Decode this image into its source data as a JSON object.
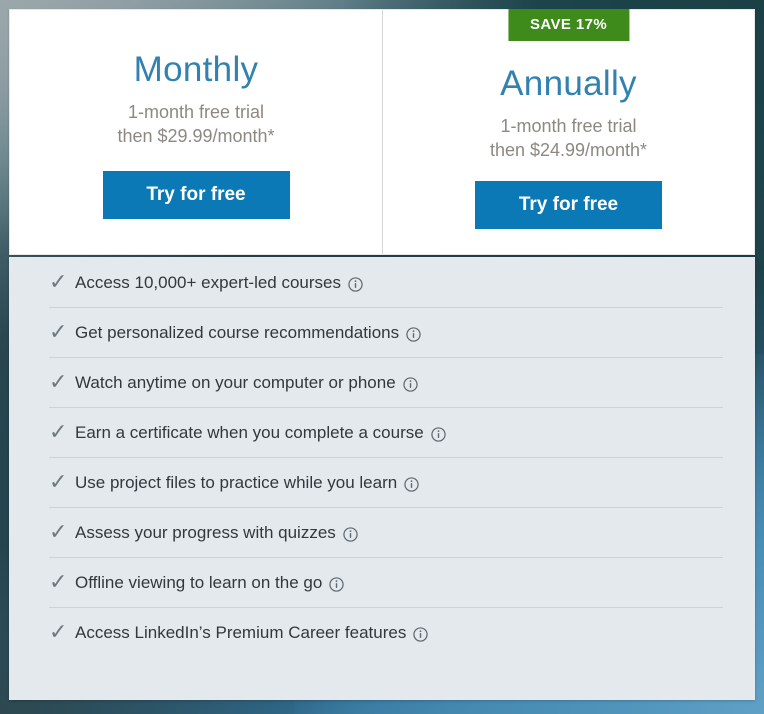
{
  "plans": [
    {
      "id": "monthly",
      "title": "Monthly",
      "trial_line": "1-month free trial",
      "price_line": "then $29.99/month*",
      "cta_label": "Try for free",
      "badge": null
    },
    {
      "id": "annually",
      "title": "Annually",
      "trial_line": "1-month free trial",
      "price_line": "then $24.99/month*",
      "cta_label": "Try for free",
      "badge": "SAVE 17%"
    }
  ],
  "features": [
    {
      "text": "Access 10,000+ expert-led courses",
      "check": "check-icon",
      "info": "info-icon"
    },
    {
      "text": "Get personalized course recommendations",
      "check": "check-icon",
      "info": "info-icon"
    },
    {
      "text": "Watch anytime on your computer or phone",
      "check": "check-icon",
      "info": "info-icon"
    },
    {
      "text": "Earn a certificate when you complete a course",
      "check": "check-icon",
      "info": "info-icon"
    },
    {
      "text": "Use project files to practice while you learn",
      "check": "check-icon",
      "info": "info-icon"
    },
    {
      "text": "Assess your progress with quizzes",
      "check": "check-icon",
      "info": "info-icon"
    },
    {
      "text": "Offline viewing to learn on the go",
      "check": "check-icon",
      "info": "info-icon"
    },
    {
      "text": "Access LinkedIn’s Premium Career features",
      "check": "check-icon",
      "info": "info-icon"
    }
  ],
  "icons": {
    "check_glyph": "✓"
  },
  "colors": {
    "cta_blue": "#0b79b5",
    "title_blue": "#3282b0",
    "badge_green": "#3e8a1b",
    "panel_gray": "#e3e9ed",
    "price_gray": "#8d8882",
    "feature_text": "#32383d",
    "divider": "#ccd4d9"
  }
}
